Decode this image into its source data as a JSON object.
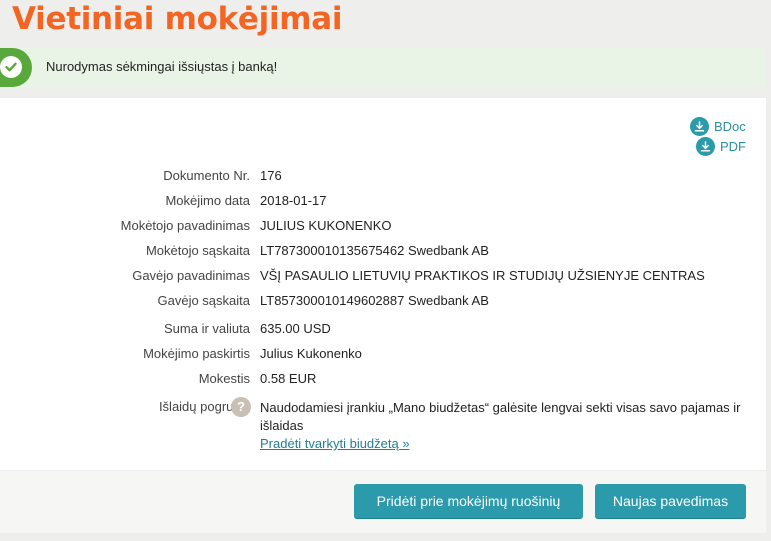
{
  "page": {
    "title": "Vietiniai mokėjimai"
  },
  "alert": {
    "message": "Nurodymas sėkmingai išsiųstas į banką!"
  },
  "downloads": {
    "bdoc": "BDoc",
    "pdf": "PDF"
  },
  "details": [
    {
      "label": "Dokumento Nr.",
      "value": "176"
    },
    {
      "label": "Mokėjimo data",
      "value": "2018-01-17"
    },
    {
      "label": "Mokėtojo pavadinimas",
      "value": "JULIUS KUKONENKO"
    },
    {
      "label": "Mokėtojo sąskaita",
      "value": "LT787300010135675462 Swedbank AB"
    },
    {
      "label": "Gavėjo pavadinimas",
      "value": "VŠĮ PASAULIO LIETUVIŲ PRAKTIKOS IR STUDIJŲ UŽSIENYJE CENTRAS"
    },
    {
      "label": "Gavėjo sąskaita",
      "value": "LT857300010149602887 Swedbank AB"
    },
    {
      "label": "Suma ir valiuta",
      "value": "635.00 USD"
    },
    {
      "label": "Mokėjimo paskirtis",
      "value": "Julius Kukonenko"
    },
    {
      "label": "Mokestis",
      "value": "0.58 EUR"
    }
  ],
  "budget": {
    "label": "Išlaidų pogrupis",
    "help": "?",
    "text_line1": "Naudodamiesi įrankiu „Mano biudžetas“ galėsite lengvai sekti visas savo pajamas ir",
    "text_line2": "išlaidas",
    "link": "Pradėti tvarkyti biudžetą »"
  },
  "buttons": {
    "add_template": "Pridėti prie mokėjimų ruošinių",
    "new_payment": "Naujas pavedimas"
  },
  "colors": {
    "accent": "#f26522",
    "primary": "#2b9aaa",
    "success": "#58a83c"
  }
}
